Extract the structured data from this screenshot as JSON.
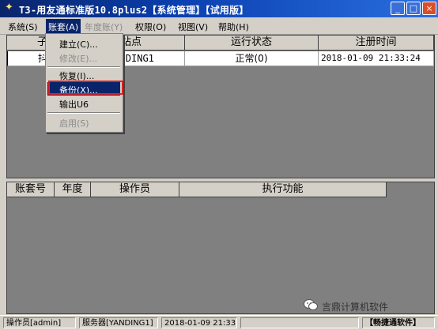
{
  "window": {
    "title": "T3-用友通标准版10.8plus2【系统管理】【试用版】",
    "controls": [
      "_",
      "□",
      "×"
    ]
  },
  "menubar": {
    "items": [
      {
        "label": "系统(S)",
        "state": "normal"
      },
      {
        "label": "账套(A)",
        "state": "active"
      },
      {
        "label": "年度账(Y)",
        "state": "disabled"
      },
      {
        "label": "权限(O)",
        "state": "normal"
      },
      {
        "label": "视图(V)",
        "state": "normal"
      },
      {
        "label": "帮助(H)",
        "state": "normal"
      }
    ]
  },
  "account_menu": {
    "items": [
      {
        "label": "建立(C)...",
        "state": "normal"
      },
      {
        "label": "修改(E)...",
        "state": "disabled"
      },
      {
        "label": "恢复(I)...",
        "state": "normal"
      },
      {
        "label": "备份(X)...",
        "state": "highlighted"
      },
      {
        "label": "输出U6",
        "state": "normal"
      },
      {
        "label": "启用(S)",
        "state": "disabled"
      }
    ]
  },
  "top_table": {
    "headers": [
      "子",
      "站点",
      "运行状态",
      "注册时间"
    ],
    "rows": [
      [
        "抖",
        "YANDING1",
        "正常(0)",
        "2018-01-09 21:33:24"
      ]
    ]
  },
  "bottom_table": {
    "headers": [
      "账套号",
      "年度",
      "操作员",
      "执行功能"
    ]
  },
  "statusbar": {
    "operator": "操作员[admin]",
    "server": "服务器[YANDING1]",
    "datetime": "2018-01-09 21:33",
    "brand": "【畅捷通软件】"
  },
  "watermark": {
    "text": "言鼎计算机软件"
  },
  "colors": {
    "titlebar": "#0a246a",
    "highlight": "#0a246a",
    "annotation_box": "#e02020",
    "panel_bg": "#808080"
  }
}
